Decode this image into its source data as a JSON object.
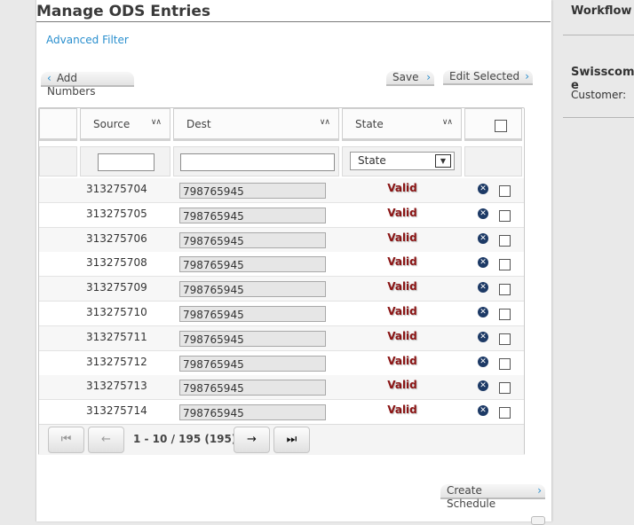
{
  "page": {
    "title": "Manage ODS Entries",
    "advanced_filter": "Advanced Filter"
  },
  "toolbar": {
    "add_numbers": "Add Numbers",
    "save": "Save",
    "edit_selected": "Edit Selected",
    "create_schedule": "Create Schedule"
  },
  "icons": {
    "back": "chevron-left-icon",
    "forward": "chevron-right-icon",
    "sort": "sort-icon",
    "delete": "delete-circle-icon"
  },
  "table": {
    "columns": {
      "source": "Source",
      "dest": "Dest",
      "state": "State"
    },
    "filters": {
      "source_value": "",
      "dest_value": "",
      "state_selected": "State"
    },
    "rows": [
      {
        "source": "313275704",
        "dest": "798765945",
        "state": "Valid"
      },
      {
        "source": "313275705",
        "dest": "798765945",
        "state": "Valid"
      },
      {
        "source": "313275706",
        "dest": "798765945",
        "state": "Valid"
      },
      {
        "source": "313275708",
        "dest": "798765945",
        "state": "Valid"
      },
      {
        "source": "313275709",
        "dest": "798765945",
        "state": "Valid"
      },
      {
        "source": "313275710",
        "dest": "798765945",
        "state": "Valid"
      },
      {
        "source": "313275711",
        "dest": "798765945",
        "state": "Valid"
      },
      {
        "source": "313275712",
        "dest": "798765945",
        "state": "Valid"
      },
      {
        "source": "313275713",
        "dest": "798765945",
        "state": "Valid"
      },
      {
        "source": "313275714",
        "dest": "798765945",
        "state": "Valid"
      }
    ],
    "pager": {
      "info": "1 - 10 / 195 (195)"
    }
  },
  "sidebar": {
    "workflow_title": "Workflow",
    "customer_title": "Swisscom e",
    "customer_label": "Customer:"
  },
  "colors": {
    "link": "#2a8fce",
    "state_valid": "#8b1414",
    "delete_icon": "#1d3a66"
  }
}
